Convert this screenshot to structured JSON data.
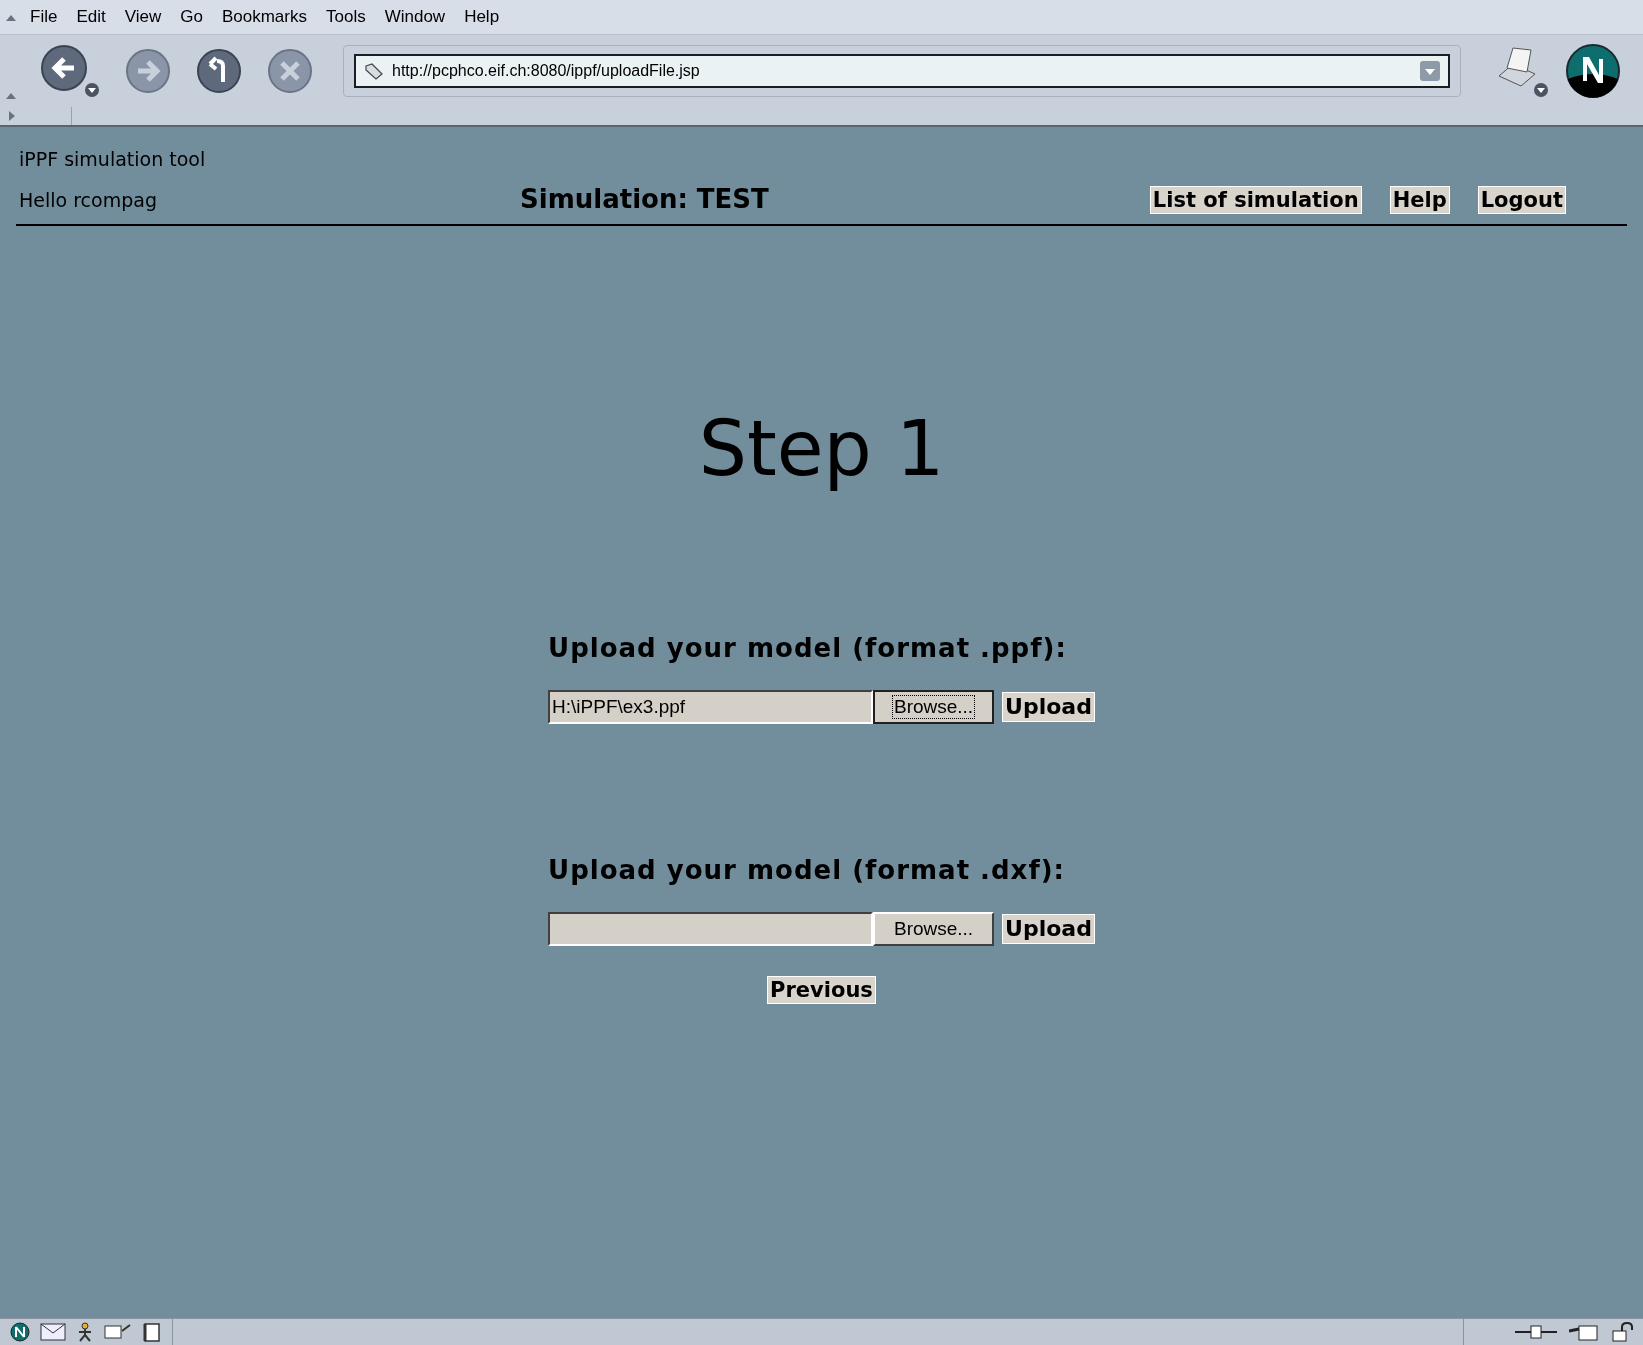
{
  "menu": [
    "File",
    "Edit",
    "View",
    "Go",
    "Bookmarks",
    "Tools",
    "Window",
    "Help"
  ],
  "url": "http://pcphco.eif.ch:8080/ippf/uploadFile.jsp",
  "header": {
    "app_name": "iPPF simulation tool",
    "greeting": "Hello rcompag",
    "title": "Simulation: TEST",
    "links": [
      "List of simulation",
      "Help",
      "Logout"
    ]
  },
  "step": "Step 1",
  "uploads": [
    {
      "heading": "Upload your model (format .ppf):",
      "value": "H:\\iPPF\\ex3.ppf",
      "browse": "Browse...",
      "browse_focused": true,
      "upload": "Upload"
    },
    {
      "heading": "Upload your model (format .dxf):",
      "browse": "Browse...",
      "browse_focused": false,
      "upload": "Upload"
    }
  ],
  "previous": "Previous"
}
